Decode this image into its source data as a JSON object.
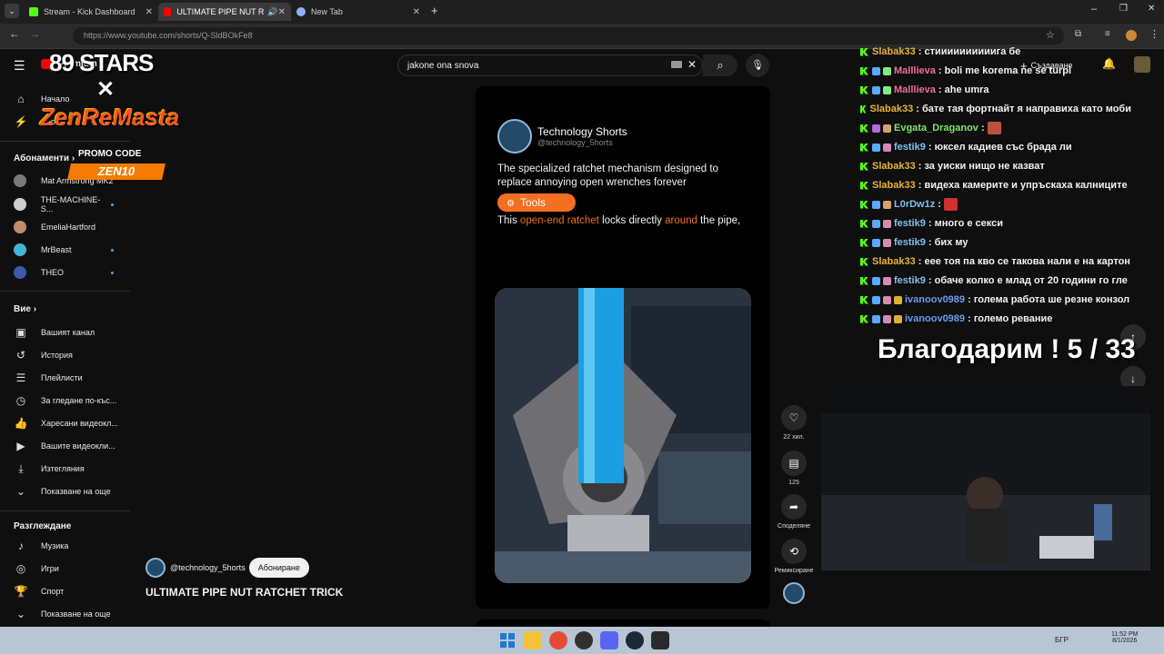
{
  "browser": {
    "tabs": [
      {
        "title": "Stream - Kick Dashboard",
        "fav_color": "#53fc18"
      },
      {
        "title": "ULTIMATE PIPE NUT RATCH",
        "fav_color": "#ff0000"
      },
      {
        "title": "New Tab",
        "fav_color": "#8ab4f8"
      }
    ],
    "url": "https://www.youtube.com/shorts/Q-SldBOkFe8"
  },
  "overlay": {
    "brand_top": "89 STARS",
    "brand_x": "✕",
    "brand_main": "ZenReMasta",
    "promo_label": "PROMO CODE",
    "promo_code": "ZEN10"
  },
  "youtube": {
    "logo": "Premium",
    "search_value": "jakone ona snova",
    "create_label": "Създаване",
    "nav": [
      {
        "label": "Начало",
        "icon": "home-icon"
      },
      {
        "label": "Shorts",
        "icon": "shorts-icon"
      }
    ],
    "subs_header": "Абонаменти",
    "subscriptions": [
      {
        "label": "Mat Armstrong MK2",
        "color": "#7a7a7a",
        "dot": false
      },
      {
        "label": "THE-MACHINE-S...",
        "color": "#cfcfcf",
        "dot": true
      },
      {
        "label": "EmeliaHartford",
        "color": "#c48a6a",
        "dot": false
      },
      {
        "label": "MrBeast",
        "color": "#3fb6d9",
        "dot": true
      },
      {
        "label": "THEO",
        "color": "#3b5ba8",
        "dot": true
      }
    ],
    "you_header": "Вие",
    "you_items": [
      {
        "label": "Вашият канал",
        "icon": "channel-icon"
      },
      {
        "label": "История",
        "icon": "history-icon"
      },
      {
        "label": "Плейлисти",
        "icon": "playlist-icon"
      },
      {
        "label": "За гледане по-къс...",
        "icon": "watch-later-icon"
      },
      {
        "label": "Харесани видеокл...",
        "icon": "like-icon"
      },
      {
        "label": "Вашите видеокли...",
        "icon": "your-videos-icon"
      },
      {
        "label": "Изтегляния",
        "icon": "download-icon"
      },
      {
        "label": "Показване на още",
        "icon": "chevron-down-icon"
      }
    ],
    "explore_header": "Разглеждане",
    "explore_items": [
      {
        "label": "Музика",
        "icon": "music-icon"
      },
      {
        "label": "Игри",
        "icon": "games-icon"
      },
      {
        "label": "Спорт",
        "icon": "trophy-icon"
      },
      {
        "label": "Показване на още",
        "icon": "chevron-down-icon"
      }
    ],
    "short": {
      "channel_name": "Technology Shorts",
      "channel_handle": "@technology_5horts",
      "post_text": "The specialized ratchet mechanism designed to replace annoying open wrenches forever",
      "tag": "Tools",
      "line_plain_1": "This ",
      "line_hl_1": "open-end ratchet",
      "line_plain_2": " locks directly ",
      "line_hl_2": "around",
      "line_plain_3": " the pipe,",
      "owner_handle": "@technology_5horts",
      "subscribe": "Абониране",
      "title": "ULTIMATE PIPE NUT RATCHET TRICK",
      "likes": "22 хил.",
      "comments": "125",
      "share": "Споделяне",
      "remix": "Ремиксиране"
    }
  },
  "chat": {
    "messages": [
      {
        "user": "Slabak33",
        "color": "#e8b33b",
        "text": "стиииииииииига бе",
        "badges": []
      },
      {
        "user": "Malllieva",
        "color": "#f06aa6",
        "text": "boli me korema ne se turpi",
        "badges": [
          "#5aa9ff",
          "#7cf07c"
        ]
      },
      {
        "user": "Malllieva",
        "color": "#f06aa6",
        "text": "ahe umra",
        "badges": [
          "#5aa9ff",
          "#7cf07c"
        ]
      },
      {
        "user": "Slabak33",
        "color": "#e8b33b",
        "text": "бате тая фортнайт я направиха като моби",
        "badges": []
      },
      {
        "user": "Evgata_Draganov",
        "color": "#7de36b",
        "text": "",
        "badges": [
          "#b06ad9",
          "#d9a26a"
        ],
        "emote": "#c0503a"
      },
      {
        "user": "festik9",
        "color": "#7fc0f0",
        "text": "юксел кадиев със брада ли",
        "badges": [
          "#5aa9ff",
          "#d98ab0"
        ]
      },
      {
        "user": "Slabak33",
        "color": "#e8b33b",
        "text": "за уиски нищо не казват",
        "badges": []
      },
      {
        "user": "Slabak33",
        "color": "#e8b33b",
        "text": "видеха камерите и упръскаха калниците",
        "badges": []
      },
      {
        "user": "L0rDw1z",
        "color": "#7fc0f0",
        "text": "",
        "badges": [
          "#5aa9ff",
          "#d9a26a"
        ],
        "emote": "#d03030"
      },
      {
        "user": "festik9",
        "color": "#7fc0f0",
        "text": "много е секси",
        "badges": [
          "#5aa9ff",
          "#d98ab0"
        ]
      },
      {
        "user": "festik9",
        "color": "#7fc0f0",
        "text": "бих му",
        "badges": [
          "#5aa9ff",
          "#d98ab0"
        ]
      },
      {
        "user": "Slabak33",
        "color": "#e8b33b",
        "text": "еее тоя па кво се такова нали е на картон",
        "badges": []
      },
      {
        "user": "festik9",
        "color": "#7fc0f0",
        "text": "обаче колко е млад от 20 години го гле",
        "badges": [
          "#5aa9ff",
          "#d98ab0"
        ]
      },
      {
        "user": "ivanoov0989",
        "color": "#6a9cf0",
        "text": "голема работа ше резне конзол",
        "badges": [
          "#5aa9ff",
          "#d98ab0",
          "#e0b030"
        ]
      },
      {
        "user": "ivanoov0989",
        "color": "#6a9cf0",
        "text": "големо ревание",
        "badges": [
          "#5aa9ff",
          "#d98ab0",
          "#e0b030"
        ]
      }
    ],
    "thanks": "Благодарим ! 5 / 33"
  },
  "taskbar": {
    "lang": "БГР",
    "time": "11:52 PM",
    "date": "8/1/2026",
    "icons": [
      "windows-icon",
      "file-explorer-icon",
      "chrome-icon",
      "obs-icon",
      "discord-icon",
      "steam-icon",
      "epic-games-icon"
    ]
  }
}
